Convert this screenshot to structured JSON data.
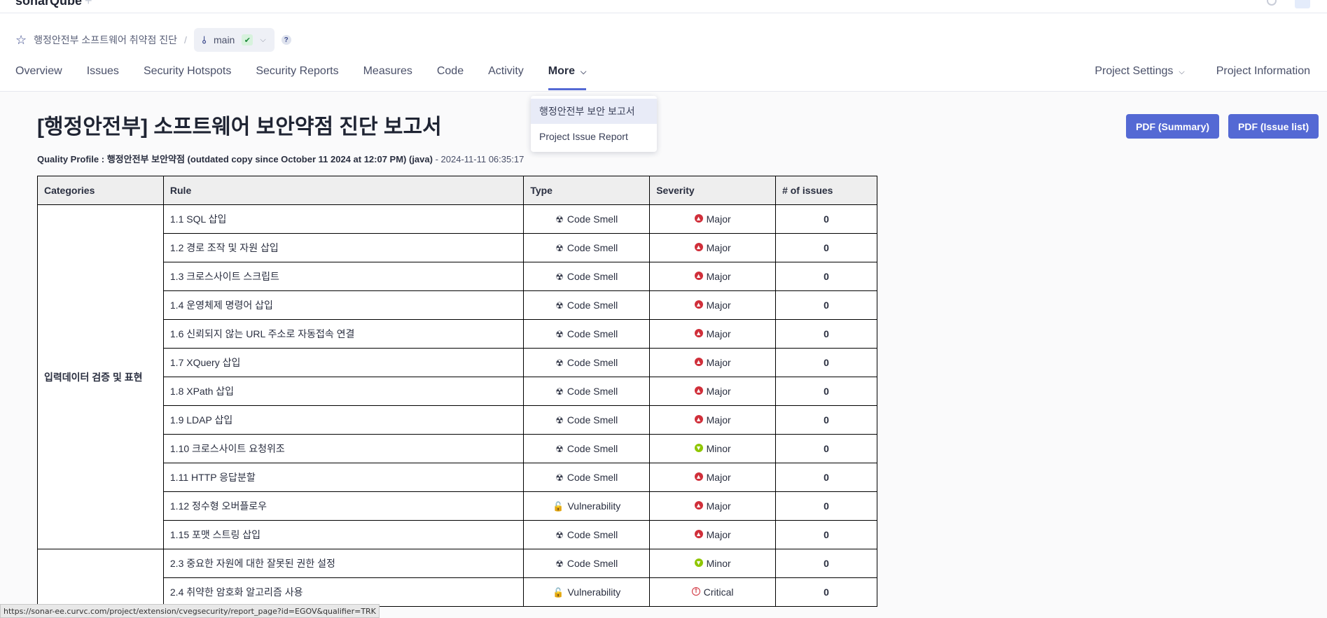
{
  "app": {
    "logo_text": "sonarQube",
    "logo_mark": "+"
  },
  "breadcrumb": {
    "project_name": "행정안전부 소프트웨어 취약점 진단",
    "separator": "/",
    "branch": "main",
    "help": "?"
  },
  "nav": {
    "items": [
      {
        "label": "Overview"
      },
      {
        "label": "Issues"
      },
      {
        "label": "Security Hotspots"
      },
      {
        "label": "Security Reports"
      },
      {
        "label": "Measures"
      },
      {
        "label": "Code"
      },
      {
        "label": "Activity"
      },
      {
        "label": "More"
      }
    ],
    "right": [
      {
        "label": "Project Settings"
      },
      {
        "label": "Project Information"
      }
    ]
  },
  "dropdown": {
    "items": [
      {
        "label": "행정안전부 보안 보고서"
      },
      {
        "label": "Project Issue Report"
      }
    ]
  },
  "report": {
    "title": "[행정안전부] 소프트웨어 보안약점 진단 보고서",
    "profile_label": "Quality Profile : ",
    "profile_value": "행정안전부 보안약점 (outdated copy since October 11 2024 at 12:07 PM) (java)",
    "timestamp": " - 2024-11-11 06:35:17",
    "pdf_summary": "PDF (Summary)",
    "pdf_issue_list": "PDF (Issue list)"
  },
  "table": {
    "headers": [
      "Categories",
      "Rule",
      "Type",
      "Severity",
      "# of issues"
    ],
    "category_1": "입력데이터 검증 및 표현",
    "rows": [
      {
        "rule": "1.1 SQL 삽입",
        "type": "Code Smell",
        "severity": "Major",
        "issues": "0"
      },
      {
        "rule": "1.2 경로 조작 및 자원 삽입",
        "type": "Code Smell",
        "severity": "Major",
        "issues": "0"
      },
      {
        "rule": "1.3 크로스사이트 스크립트",
        "type": "Code Smell",
        "severity": "Major",
        "issues": "0"
      },
      {
        "rule": "1.4 운영체제 명령어 삽입",
        "type": "Code Smell",
        "severity": "Major",
        "issues": "0"
      },
      {
        "rule": "1.6 신뢰되지 않는 URL 주소로 자동접속 연결",
        "type": "Code Smell",
        "severity": "Major",
        "issues": "0"
      },
      {
        "rule": "1.7 XQuery 삽입",
        "type": "Code Smell",
        "severity": "Major",
        "issues": "0"
      },
      {
        "rule": "1.8 XPath 삽입",
        "type": "Code Smell",
        "severity": "Major",
        "issues": "0"
      },
      {
        "rule": "1.9 LDAP 삽입",
        "type": "Code Smell",
        "severity": "Major",
        "issues": "0"
      },
      {
        "rule": "1.10 크로스사이트 요청위조",
        "type": "Code Smell",
        "severity": "Minor",
        "issues": "0"
      },
      {
        "rule": "1.11 HTTP 응답분할",
        "type": "Code Smell",
        "severity": "Major",
        "issues": "0"
      },
      {
        "rule": "1.12 정수형 오버플로우",
        "type": "Vulnerability",
        "severity": "Major",
        "issues": "0"
      },
      {
        "rule": "1.15 포맷 스트링 삽입",
        "type": "Code Smell",
        "severity": "Major",
        "issues": "0"
      },
      {
        "rule": "2.3 중요한 자원에 대한 잘못된 권한 설정",
        "type": "Code Smell",
        "severity": "Minor",
        "issues": "0"
      },
      {
        "rule": "2.4 취약한 암호화 알고리즘 사용",
        "type": "Vulnerability",
        "severity": "Critical",
        "issues": "0"
      }
    ]
  },
  "colors": {
    "accent": "#5469d4",
    "major": "#d02f3a",
    "critical": "#d02f3a",
    "minor": "#8fc600"
  },
  "icons": {
    "code_smell": "radiation-icon",
    "vulnerability": "lock-icon",
    "major": "arrow-up-icon",
    "minor": "arrow-down-icon",
    "critical": "double-arrow-up-icon"
  },
  "status_bar": {
    "url": "https://sonar-ee.curvc.com/project/extension/cvegsecurity/report_page?id=EGOV&qualifier=TRK"
  }
}
